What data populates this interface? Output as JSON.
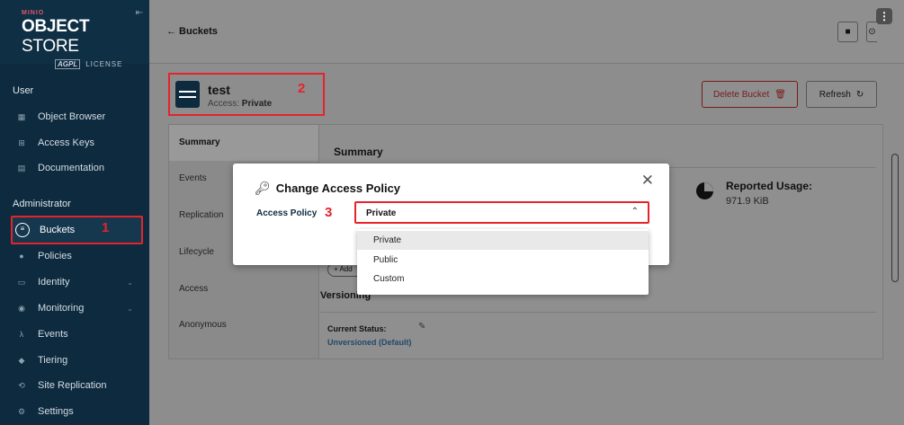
{
  "sidebar": {
    "logo": {
      "brand": "MINIO",
      "product_bold": "OBJECT",
      "product_rest": " STORE",
      "license_badge": "AGPL",
      "license_text": "LICENSE"
    },
    "sections": {
      "user": "User",
      "admin": "Administrator"
    },
    "user_items": [
      {
        "label": "Object Browser",
        "icon": "object-browser-icon"
      },
      {
        "label": "Access Keys",
        "icon": "access-keys-icon"
      },
      {
        "label": "Documentation",
        "icon": "documentation-icon"
      }
    ],
    "admin_items": [
      {
        "label": "Buckets",
        "icon": "bucket-icon",
        "active": true
      },
      {
        "label": "Policies",
        "icon": "policies-icon"
      },
      {
        "label": "Identity",
        "icon": "identity-icon",
        "expandable": true
      },
      {
        "label": "Monitoring",
        "icon": "monitoring-icon",
        "expandable": true
      },
      {
        "label": "Events",
        "icon": "lambda-icon"
      },
      {
        "label": "Tiering",
        "icon": "tiering-icon"
      },
      {
        "label": "Site Replication",
        "icon": "site-replication-icon"
      },
      {
        "label": "Settings",
        "icon": "settings-icon"
      }
    ],
    "annotation": "1"
  },
  "topbar": {
    "back_label": "← Buckets"
  },
  "bucket": {
    "name": "test",
    "access_prefix": "Access: ",
    "access_value": "Private",
    "annotation": "2",
    "delete_label": "Delete Bucket",
    "refresh_label": "Refresh"
  },
  "tabs": [
    "Summary",
    "Events",
    "Replication",
    "Lifecycle",
    "Access",
    "Anonymous"
  ],
  "summary": {
    "heading": "Summary",
    "usage_title": "Reported Usage:",
    "usage_value": "971.9 KiB",
    "add_chip": "+ Add",
    "versioning_heading": "Versioning",
    "current_status_label": "Current Status:",
    "current_status_value": "Unversioned (Default)"
  },
  "modal": {
    "title": "Change Access Policy",
    "field_label": "Access Policy",
    "annotation": "3",
    "selected": "Private",
    "options": [
      "Private",
      "Public",
      "Custom"
    ]
  },
  "colors": {
    "sidebar_bg": "#0d2a3e",
    "annotation_red": "#e5232b",
    "overlay_gray": "#8f8f8f"
  }
}
